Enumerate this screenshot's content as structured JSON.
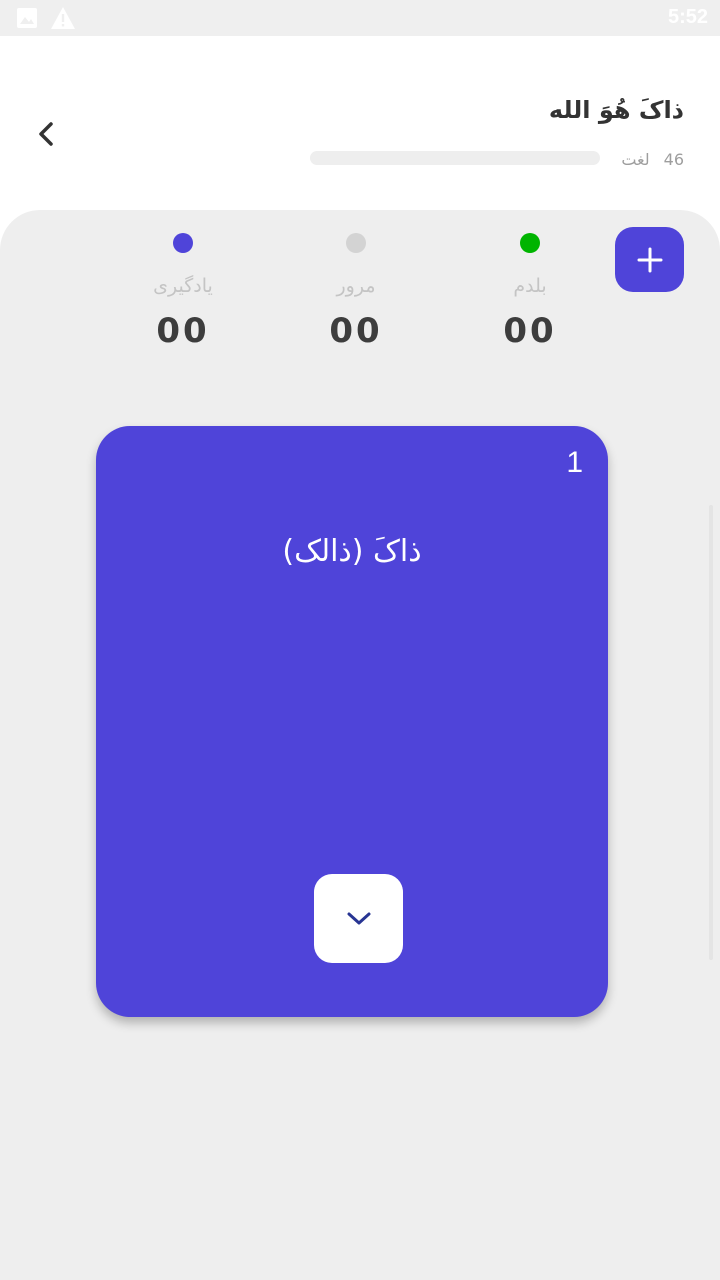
{
  "status_bar": {
    "time": "5:52",
    "icons": [
      "image-icon",
      "warning-icon"
    ]
  },
  "header": {
    "title": "ذاکَ هُوَ الله",
    "word_count": "46",
    "word_unit": "لغت",
    "progress": 0
  },
  "stats": [
    {
      "label": "بلدم",
      "count": "00",
      "dot_color": "#00b400"
    },
    {
      "label": "مرور",
      "count": "00",
      "dot_color": "#d3d3d3"
    },
    {
      "label": "یادگیری",
      "count": "00",
      "dot_color": "#4f44d9"
    }
  ],
  "card": {
    "index": "1",
    "word": "ذاکَ (ذالک)"
  },
  "colors": {
    "accent": "#4f44d9",
    "panel_bg": "#eeeeee"
  }
}
